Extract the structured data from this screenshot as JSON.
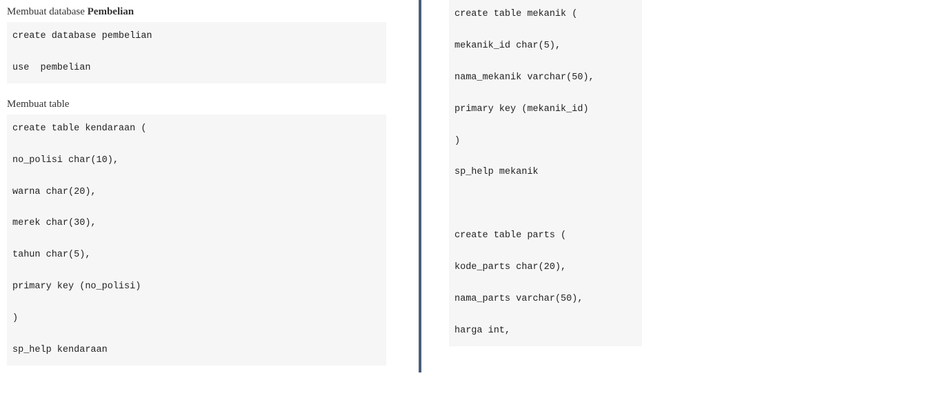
{
  "left": {
    "heading1_prefix": "Membuat database ",
    "heading1_bold": "Pembelian",
    "code1": "create database pembelian\n\nuse  pembelian",
    "heading2": "Membuat table",
    "code2": "create table kendaraan (\n\nno_polisi char(10),\n\nwarna char(20),\n\nmerek char(30),\n\ntahun char(5),\n\nprimary key (no_polisi)\n\n)\n\nsp_help kendaraan"
  },
  "right": {
    "code1": "create table mekanik (\n\nmekanik_id char(5),\n\nnama_mekanik varchar(50),\n\nprimary key (mekanik_id)\n\n)\n\nsp_help mekanik\n\n\n\ncreate table parts (\n\nkode_parts char(20),\n\nnama_parts varchar(50),\n\nharga int,"
  }
}
